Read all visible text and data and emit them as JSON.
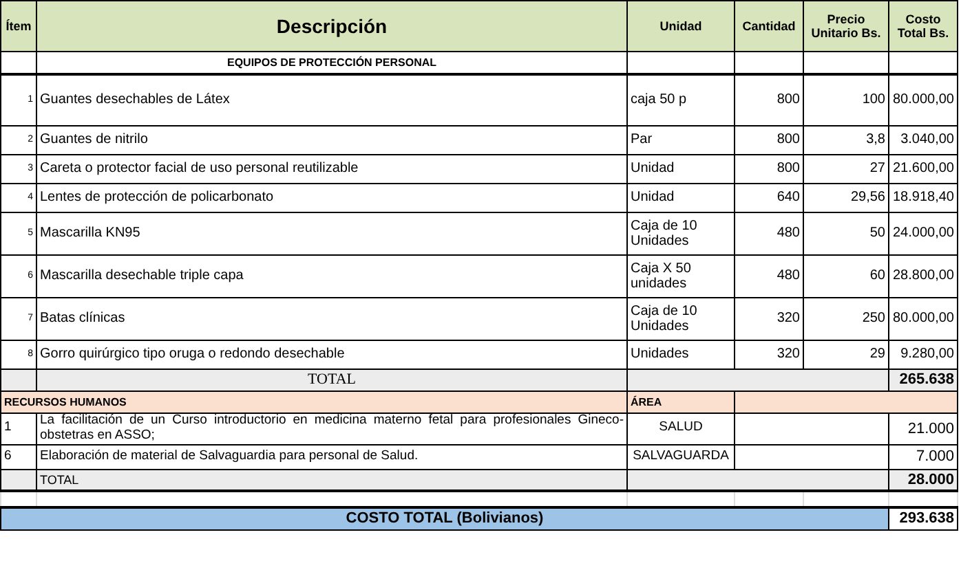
{
  "table": {
    "columns": [
      "Ítem",
      "Descripción",
      "Unidad",
      "Cantidad",
      "Precio Unitario Bs.",
      "Costo Total Bs."
    ],
    "epp": {
      "title": "EQUIPOS DE PROTECCIÓN PERSONAL",
      "rows": [
        {
          "item": "1",
          "description": "Guantes desechables de Látex",
          "unit": "caja 50 p",
          "quantity": "800",
          "unit_price": "100",
          "total": "80.000,00"
        },
        {
          "item": "2",
          "description": "Guantes de nitrilo",
          "unit": "Par",
          "quantity": "800",
          "unit_price": "3,8",
          "total": "3.040,00"
        },
        {
          "item": "3",
          "description": "Careta o protector facial de uso personal reutilizable",
          "unit": "Unidad",
          "quantity": "800",
          "unit_price": "27",
          "total": "21.600,00"
        },
        {
          "item": "4",
          "description": "Lentes de protección de policarbonato",
          "unit": "Unidad",
          "quantity": "640",
          "unit_price": "29,56",
          "total": "18.918,40"
        },
        {
          "item": "5",
          "description": "Mascarilla KN95",
          "unit": "Caja de 10 Unidades",
          "quantity": "480",
          "unit_price": "50",
          "total": "24.000,00"
        },
        {
          "item": "6",
          "description": "Mascarilla desechable triple capa",
          "unit": "Caja X 50 unidades",
          "quantity": "480",
          "unit_price": "60",
          "total": "28.800,00"
        },
        {
          "item": "7",
          "description": "Batas clínicas",
          "unit": "Caja de 10 Unidades",
          "quantity": "320",
          "unit_price": "250",
          "total": "80.000,00"
        },
        {
          "item": "8",
          "description": "Gorro quirúrgico tipo oruga o redondo desechable",
          "unit": "Unidades",
          "quantity": "320",
          "unit_price": "29",
          "total": "9.280,00"
        }
      ],
      "total_label": "TOTAL",
      "total": "265.638"
    },
    "rrhh": {
      "title": "RECURSOS HUMANOS",
      "area_heading": "ÁREA",
      "rows": [
        {
          "item": "1",
          "description": "La facilitación de un Curso introductorio en medicina materno fetal para profesionales Gineco-obstetras en ASSO;",
          "area": "SALUD",
          "total": "21.000"
        },
        {
          "item": "6",
          "description": "Elaboración de material de Salvaguardia para personal de Salud.",
          "area": "SALVAGUARDA",
          "total": "7.000"
        }
      ],
      "total_label": "TOTAL",
      "total": "28.000"
    },
    "grand_total": {
      "label": "COSTO TOTAL (Bolivianos)",
      "value": "293.638"
    }
  }
}
